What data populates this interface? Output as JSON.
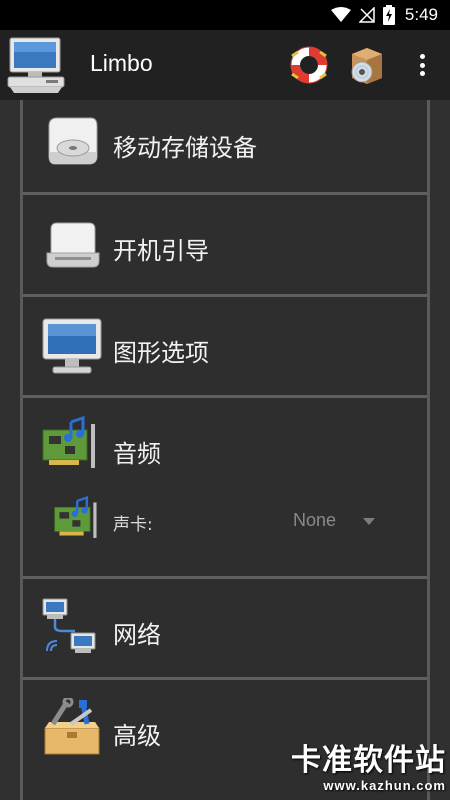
{
  "status_bar": {
    "time": "5:49",
    "icons": [
      "wifi-icon",
      "cellular-off-icon",
      "battery-charging-icon"
    ]
  },
  "app_bar": {
    "title": "Limbo",
    "logo_icon": "computer-icon",
    "actions": [
      "help-lifebuoy-icon",
      "install-disc-box-icon",
      "overflow-menu-icon"
    ]
  },
  "sections": [
    {
      "label": "移动存储设备",
      "icon": "removable-disk-icon"
    },
    {
      "label": "开机引导",
      "icon": "disk-drive-icon"
    },
    {
      "label": "图形选项",
      "icon": "monitor-icon"
    },
    {
      "label": "音频",
      "icon": "sound-card-icon",
      "sound_card": {
        "label": "声卡:",
        "value": "None"
      }
    },
    {
      "label": "网络",
      "icon": "network-icon"
    },
    {
      "label": "高级",
      "icon": "toolbox-icon"
    }
  ],
  "watermark": {
    "title": "卡准软件站",
    "url": "www.kazhun.com"
  },
  "colors": {
    "app_bar": "#212121",
    "background": "#303030",
    "divider": "#5f5f5f",
    "text": "#f2f2f2",
    "hint": "#8a8a8a"
  }
}
